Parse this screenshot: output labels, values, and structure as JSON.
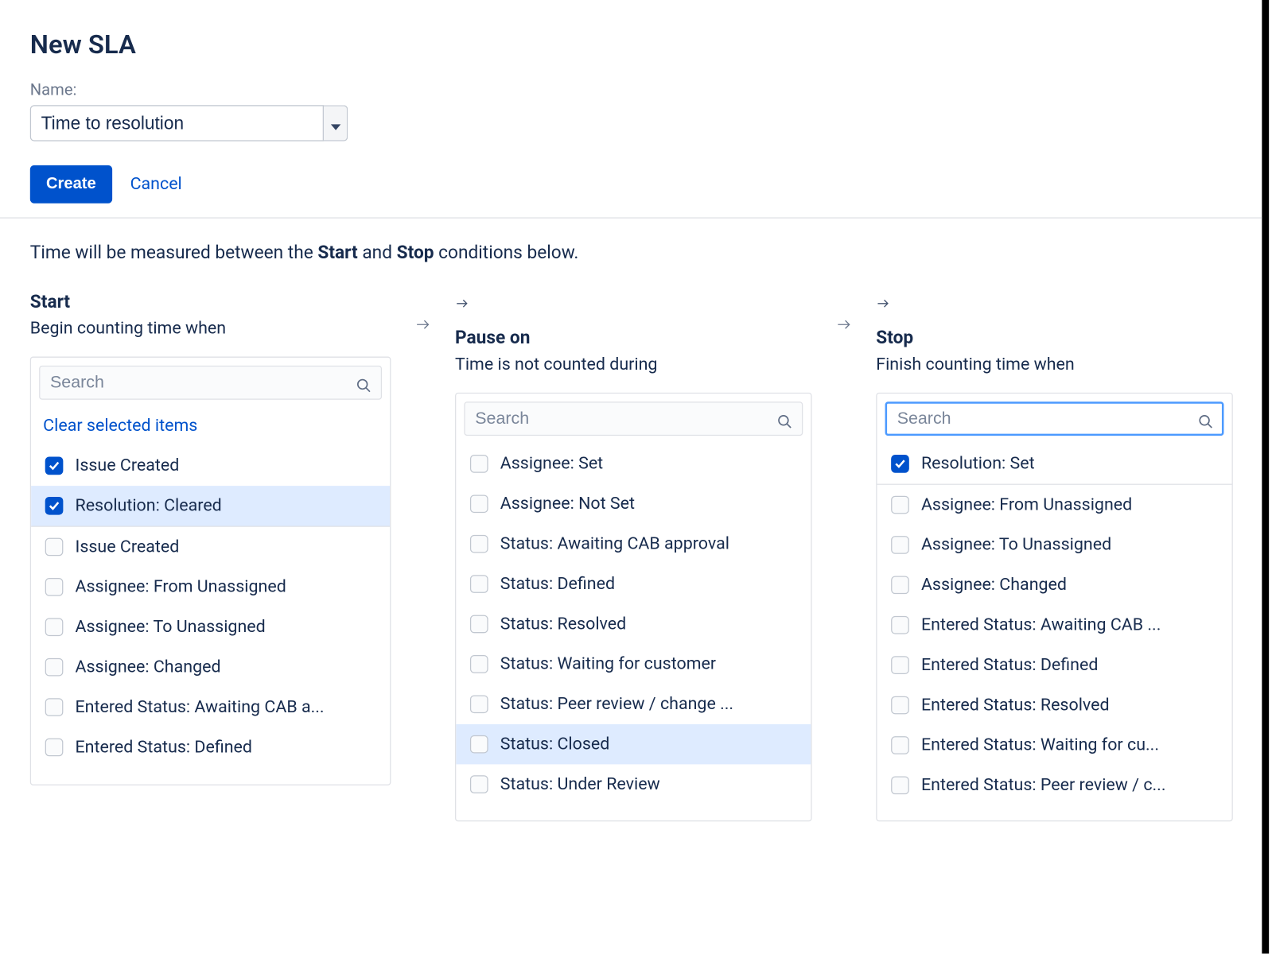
{
  "page_title": "New SLA",
  "name_label": "Name:",
  "name_value": "Time to resolution",
  "buttons": {
    "create": "Create",
    "cancel": "Cancel"
  },
  "intro": {
    "pre": "Time will be measured between the ",
    "start": "Start",
    "mid": " and ",
    "stop": "Stop",
    "post": " conditions below."
  },
  "columns": {
    "start": {
      "heading": "Start",
      "sub": "Begin counting time when",
      "search_placeholder": "Search",
      "clear": "Clear selected items",
      "selected": [
        {
          "label": "Issue Created",
          "checked": true,
          "hl": false
        },
        {
          "label": "Resolution: Cleared",
          "checked": true,
          "hl": true
        }
      ],
      "items": [
        {
          "label": "Issue Created"
        },
        {
          "label": "Assignee: From Unassigned"
        },
        {
          "label": "Assignee: To Unassigned"
        },
        {
          "label": "Assignee: Changed"
        },
        {
          "label": "Entered Status: Awaiting CAB a..."
        },
        {
          "label": "Entered Status: Defined"
        }
      ]
    },
    "pause": {
      "heading": "Pause on",
      "sub": "Time is not counted during",
      "search_placeholder": "Search",
      "items": [
        {
          "label": "Assignee: Set",
          "hl": false
        },
        {
          "label": "Assignee: Not Set",
          "hl": false
        },
        {
          "label": "Status: Awaiting CAB approval",
          "hl": false
        },
        {
          "label": "Status: Defined",
          "hl": false
        },
        {
          "label": "Status: Resolved",
          "hl": false
        },
        {
          "label": "Status: Waiting for customer",
          "hl": false
        },
        {
          "label": "Status: Peer review / change ...",
          "hl": false
        },
        {
          "label": "Status: Closed",
          "hl": true
        },
        {
          "label": "Status: Under Review",
          "hl": false
        }
      ]
    },
    "stop": {
      "heading": "Stop",
      "sub": "Finish counting time when",
      "search_placeholder": "Search",
      "selected": [
        {
          "label": "Resolution: Set",
          "checked": true
        }
      ],
      "items": [
        {
          "label": "Assignee: From Unassigned"
        },
        {
          "label": "Assignee: To Unassigned"
        },
        {
          "label": "Assignee: Changed"
        },
        {
          "label": "Entered Status: Awaiting CAB ..."
        },
        {
          "label": "Entered Status: Defined"
        },
        {
          "label": "Entered Status: Resolved"
        },
        {
          "label": "Entered Status: Waiting for cu..."
        },
        {
          "label": "Entered Status: Peer review / c..."
        }
      ]
    }
  }
}
